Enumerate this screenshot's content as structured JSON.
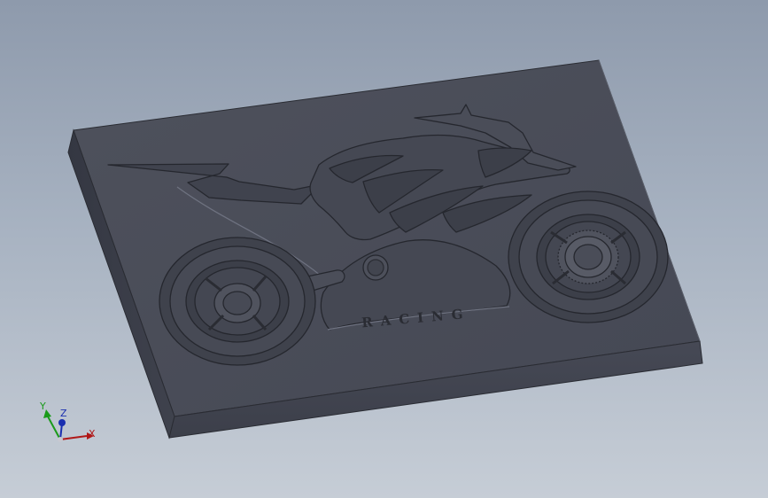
{
  "viewport": {
    "model": {
      "engraved_text": "RACING"
    },
    "triad": {
      "x_label": "X",
      "y_label": "Y",
      "z_label": "Z",
      "x_color": "#b01818",
      "y_color": "#1a9a1a",
      "z_color": "#1a2fb0"
    },
    "colors": {
      "plate_top": "#4a4d58",
      "plate_left": "#3a3d47",
      "plate_front": "#404350",
      "relief_line": "#2a2c33",
      "highlight": "#7a7e8c"
    }
  }
}
